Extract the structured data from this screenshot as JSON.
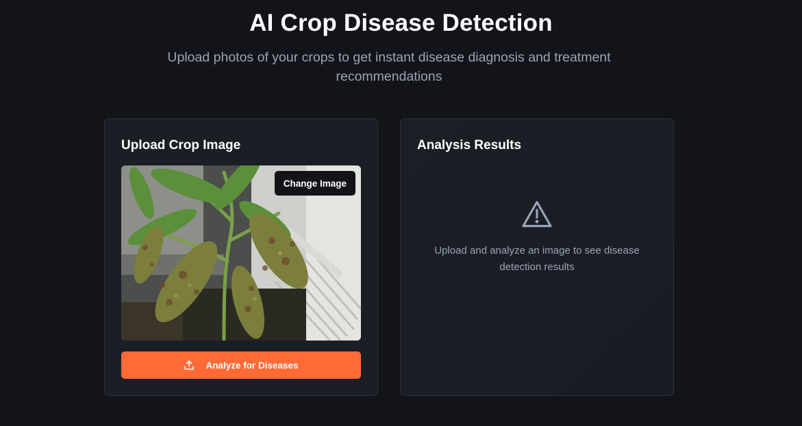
{
  "header": {
    "title": "AI Crop Disease Detection",
    "subtitle": "Upload photos of your crops to get instant disease diagnosis and treatment recommendations"
  },
  "upload_card": {
    "title": "Upload Crop Image",
    "change_image_label": "Change Image",
    "analyze_label": "Analyze for Diseases",
    "analyze_icon": "upload-icon",
    "accent_color": "#ff6a36"
  },
  "results_card": {
    "title": "Analysis Results",
    "empty_icon": "warning-icon",
    "empty_message": "Upload and analyze an image to see disease detection results"
  }
}
